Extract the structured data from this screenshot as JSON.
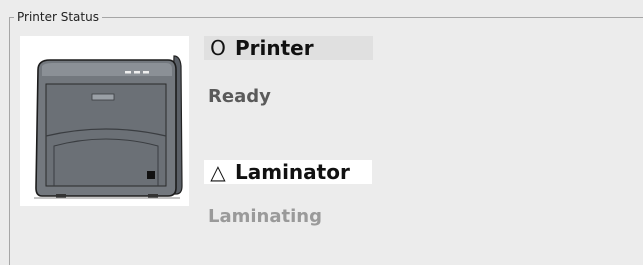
{
  "group": {
    "legend": "Printer Status"
  },
  "printer": {
    "symbol": "O",
    "title": "Printer",
    "state": "Ready"
  },
  "laminator": {
    "symbol": "△",
    "title": "Laminator",
    "state": "Laminating"
  },
  "device_image": {
    "icon": "printer-laminator-device-icon"
  }
}
